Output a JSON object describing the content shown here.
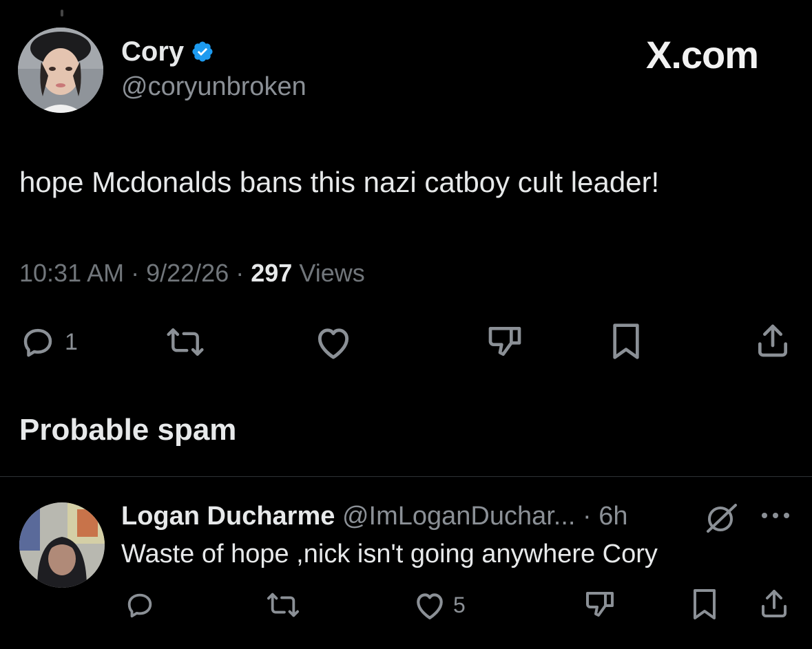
{
  "header": {
    "display_name": "Cory",
    "handle": "@coryunbroken",
    "brand": "X.com"
  },
  "tweet": {
    "text": "hope Mcdonalds bans this nazi catboy cult leader!",
    "time": "10:31 AM",
    "date": "9/22/26",
    "views_count": "297",
    "views_label": "Views",
    "separator": " · "
  },
  "actions": {
    "reply_count": "1",
    "icons": [
      "reply-icon",
      "retweet-icon",
      "like-icon",
      "dislike-icon",
      "bookmark-icon",
      "share-icon"
    ]
  },
  "section": {
    "title": "Probable spam"
  },
  "reply": {
    "display_name": "Logan Ducharme",
    "handle": "@ImLoganDuchar...",
    "time": "6h",
    "separator": " · ",
    "text": "Waste of hope ,nick isn't going anywhere Cory",
    "like_count": "5"
  },
  "colors": {
    "background": "#000000",
    "text": "#e7e9ea",
    "secondary": "#71767b",
    "verified": "#1d9bf0",
    "divider": "#2f3336"
  }
}
